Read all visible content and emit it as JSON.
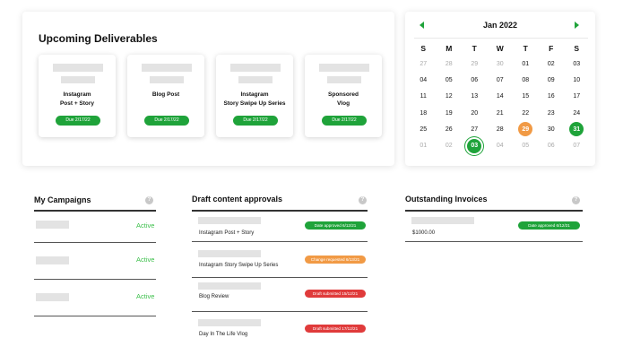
{
  "deliverables": {
    "title": "Upcoming Deliverables",
    "cards": [
      {
        "name_line1": "Instagram",
        "name_line2": "Post + Story",
        "due": "Due 2/17/22"
      },
      {
        "name_line1": "Blog Post",
        "name_line2": "",
        "due": "Due 2/17/22"
      },
      {
        "name_line1": "Instagram",
        "name_line2": "Story Swipe Up Series",
        "due": "Due 2/17/22"
      },
      {
        "name_line1": "Sponsored",
        "name_line2": "Vlog",
        "due": "Due 2/17/22"
      }
    ],
    "due_color": "#1fa33a"
  },
  "calendar": {
    "month_label": "Jan 2022",
    "weekdays": [
      "S",
      "M",
      "T",
      "W",
      "T",
      "F",
      "S"
    ],
    "weeks": [
      [
        "27",
        "28",
        "29",
        "30",
        "01",
        "02",
        "03"
      ],
      [
        "04",
        "05",
        "06",
        "07",
        "08",
        "09",
        "10"
      ],
      [
        "11",
        "12",
        "13",
        "14",
        "15",
        "16",
        "17"
      ],
      [
        "18",
        "19",
        "20",
        "21",
        "22",
        "23",
        "24"
      ],
      [
        "25",
        "26",
        "27",
        "28",
        "29",
        "30",
        "31"
      ],
      [
        "01",
        "02",
        "03",
        "04",
        "05",
        "06",
        "07"
      ]
    ],
    "muted_cells": [
      "0-0",
      "0-1",
      "0-2",
      "0-3",
      "5-0",
      "5-1",
      "5-3",
      "5-4",
      "5-5",
      "5-6"
    ],
    "highlight_orange": [
      "4-4"
    ],
    "highlight_green": [
      "4-6"
    ],
    "highlight_ring": [
      "5-2"
    ],
    "accent_green": "#1fa33a",
    "accent_orange": "#f19a45",
    "prev_icon": "triangle-left-icon",
    "next_icon": "triangle-right-icon"
  },
  "campaigns": {
    "title": "My Campaigns",
    "help_icon": "help-circle-icon",
    "rows": [
      {
        "status": "Active"
      },
      {
        "status": "Active"
      },
      {
        "status": "Active"
      }
    ]
  },
  "approvals": {
    "title": "Draft content approvals",
    "help_icon": "help-circle-icon",
    "rows": [
      {
        "name": "Instagram Post + Story",
        "badge": "Date approved 6/12/21",
        "badge_color": "#1fa33a"
      },
      {
        "name": "Instagram Story Swipe Up Series",
        "badge": "Change requested 6/13/21",
        "badge_color": "#f19a45"
      },
      {
        "name": "Blog Review",
        "badge": "Draft submitted 15/12/21",
        "badge_color": "#e03b3b"
      },
      {
        "name": "Day In The Life Vlog",
        "badge": "Draft submitted 17/12/21",
        "badge_color": "#e03b3b"
      }
    ]
  },
  "invoices": {
    "title": "Outstanding Invoices",
    "help_icon": "help-circle-icon",
    "rows": [
      {
        "amount": "$1000.00",
        "badge": "Date approved 6/12/21",
        "badge_color": "#1fa33a"
      }
    ]
  }
}
